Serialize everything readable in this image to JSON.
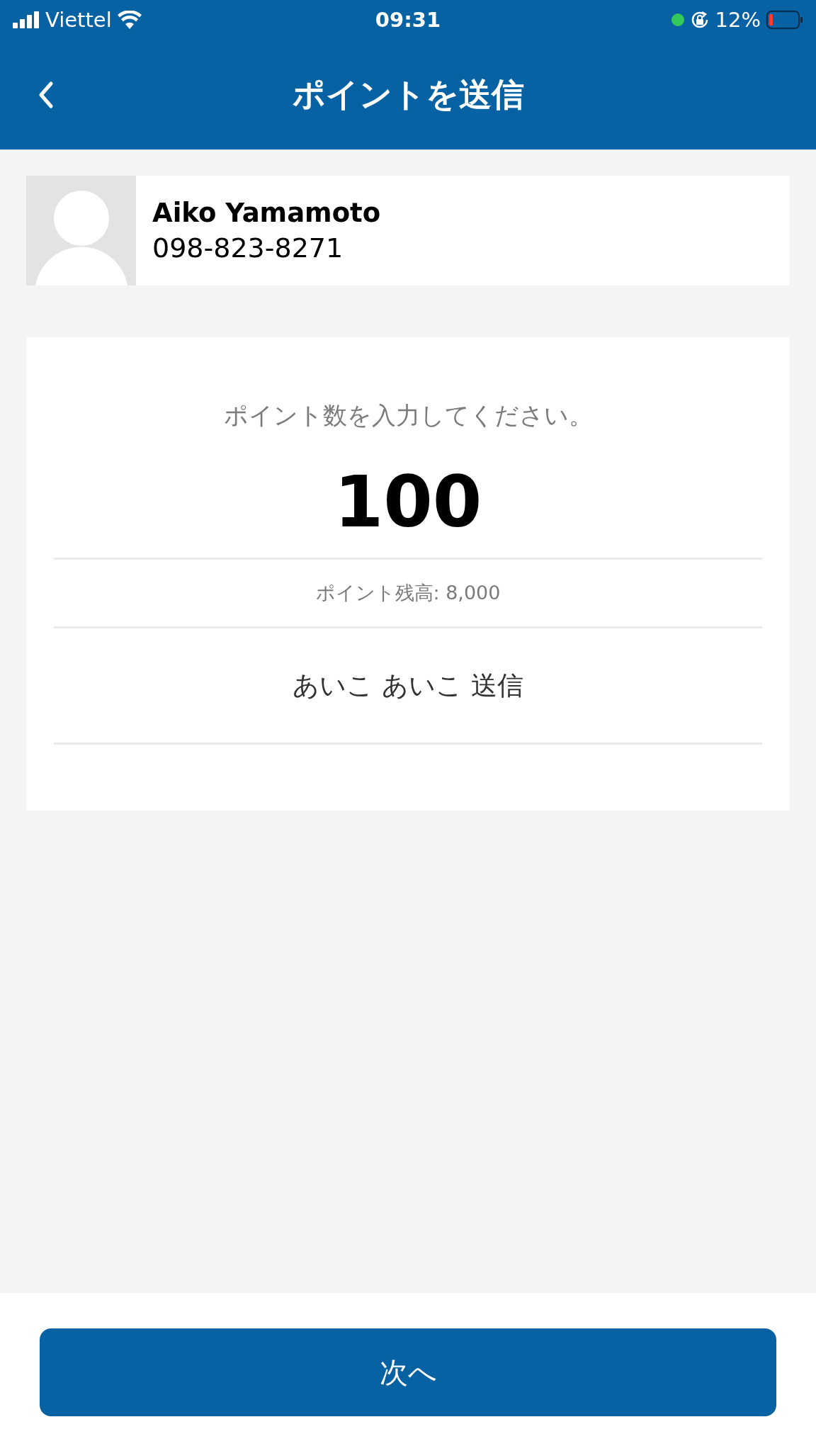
{
  "status_bar": {
    "carrier": "Viettel",
    "time": "09:31",
    "battery": "12%"
  },
  "header": {
    "title": "ポイントを送信"
  },
  "recipient": {
    "name": "Aiko Yamamoto",
    "phone": "098-823-8271"
  },
  "points_form": {
    "prompt": "ポイント数を入力してください。",
    "amount": "100",
    "balance": "ポイント残高: 8,000",
    "message": "あいこ あいこ 送信"
  },
  "next_button": {
    "label": "次へ"
  }
}
